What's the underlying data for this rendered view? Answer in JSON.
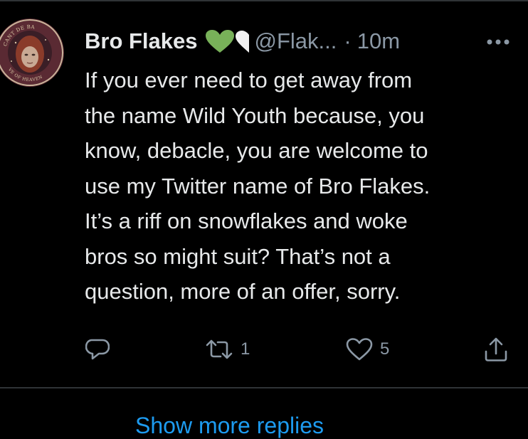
{
  "tweet": {
    "display_name": "Bro Flakes",
    "badges": [
      "green-heart-icon",
      "white-half-heart-icon"
    ],
    "handle": "@Flak...",
    "separator": "·",
    "timestamp": "10m",
    "text_lines": [
      "If you ever need to get away from",
      "the name Wild Youth because, you",
      "know, debacle, you are welcome to",
      "use my Twitter name of Bro Flakes.",
      "It’s a riff on snowflakes and woke",
      "bros so might suit? That’s not a",
      "question, more of an offer, sorry."
    ],
    "avatar_text": {
      "top": "CANT DE BA",
      "bottom": "VE OF HEAVEN"
    },
    "actions": {
      "reply_icon": "reply-icon",
      "retweet_icon": "retweet-icon",
      "retweet_count": "1",
      "like_icon": "heart-icon",
      "like_count": "5",
      "share_icon": "share-icon"
    }
  },
  "footer": {
    "show_more_replies": "Show more replies"
  },
  "colors": {
    "background": "#000000",
    "text_primary": "#e7e9ea",
    "text_secondary": "#8b98a5",
    "accent": "#1d9bf0",
    "green_heart": "#78b159",
    "divider": "#2f3336"
  }
}
